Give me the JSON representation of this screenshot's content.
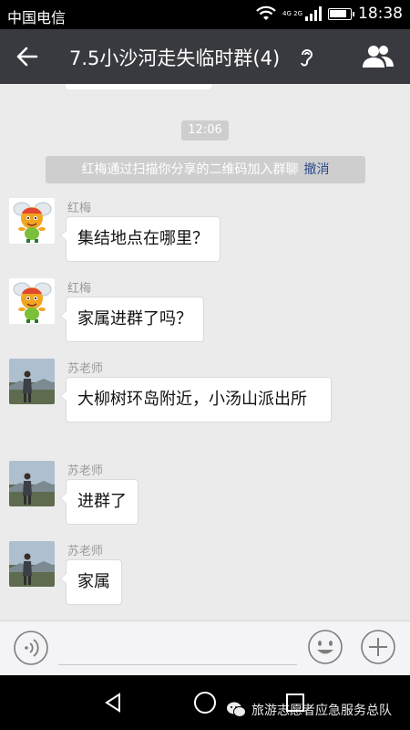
{
  "status_bar": {
    "carrier": "中国电信",
    "network_label": "4G 2G",
    "battery_level": 0.85,
    "time": "18:38"
  },
  "header": {
    "title": "7.5小沙河走失临时群(4)",
    "back_icon": "arrow-left-icon",
    "mute_icon": "ear-icon",
    "members_icon": "people-icon"
  },
  "chat": {
    "time_divider": "12:06",
    "system_notice": {
      "text": "红梅通过扫描你分享的二维码加入群聊",
      "action": "撤消"
    },
    "messages": [
      {
        "sender": "红梅",
        "avatar": "cartoon-bee-avatar",
        "text": "集结地点在哪里？"
      },
      {
        "sender": "红梅",
        "avatar": "cartoon-bee-avatar",
        "text": "家属进群了吗？"
      },
      {
        "sender": "苏老师",
        "avatar": "person-photo-avatar",
        "text": "大柳树环岛附近，小汤山派出所"
      },
      {
        "sender": "苏老师",
        "avatar": "person-photo-avatar",
        "text": "进群了"
      },
      {
        "sender": "苏老师",
        "avatar": "person-photo-avatar",
        "text": "家属"
      }
    ]
  },
  "input_bar": {
    "voice_icon": "voice-icon",
    "emoji_icon": "smiley-icon",
    "more_icon": "plus-icon"
  },
  "watermark": {
    "icon": "wechat-icon",
    "text": "旅游志愿者应急服务总队"
  },
  "colors": {
    "header_bg": "#393a3f",
    "chat_bg": "#ebebeb",
    "link": "#2b4a8b"
  }
}
